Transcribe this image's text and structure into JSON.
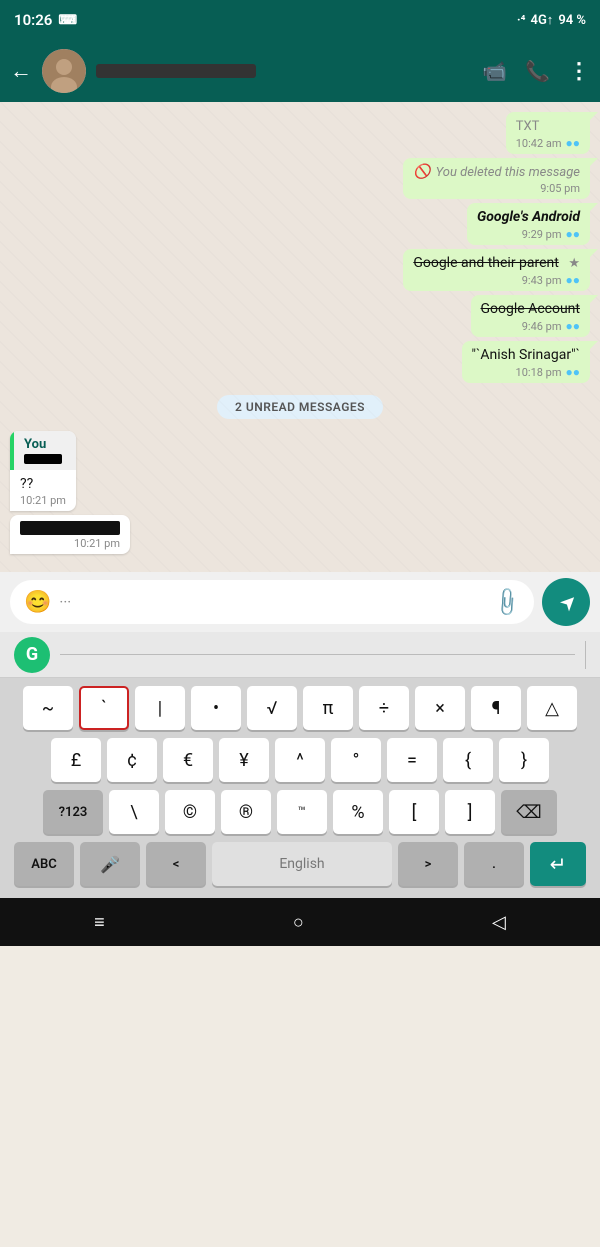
{
  "statusBar": {
    "time": "10:26",
    "signal": "4G↑",
    "battery": "94 %"
  },
  "header": {
    "back_label": "←",
    "name_redacted": true,
    "video_icon": "📹",
    "call_icon": "📞",
    "more_icon": "⋮"
  },
  "chat": {
    "messages": [
      {
        "type": "sent",
        "text": "TXT",
        "time": "10:42 am",
        "ticks": "●●",
        "strikethrough": false,
        "deleted": false,
        "italic": false
      },
      {
        "type": "sent",
        "text": "You deleted this message",
        "time": "9:05 pm",
        "deleted": true,
        "ticks": "",
        "strikethrough": false,
        "italic": false
      },
      {
        "type": "sent",
        "text": "Google's Android",
        "time": "9:29 pm",
        "ticks": "●●",
        "strikethrough": false,
        "deleted": false,
        "italic": true
      },
      {
        "type": "sent",
        "text": "Google and their parent",
        "time": "9:43 pm",
        "ticks": "●●",
        "strikethrough": true,
        "deleted": false,
        "italic": false
      },
      {
        "type": "sent",
        "text": "Google Account",
        "time": "9:46 pm",
        "ticks": "●●",
        "strikethrough": true,
        "deleted": false,
        "italic": false
      },
      {
        "type": "sent",
        "text": "\"`Anish Srinagar\"`",
        "time": "10:18 pm",
        "ticks": "●●",
        "strikethrough": false,
        "deleted": false,
        "italic": false
      }
    ],
    "unread_label": "2 UNREAD MESSAGES",
    "quoted_message": {
      "sender": "You",
      "preview_redacted": true,
      "body_text": "??",
      "body_time": "10:21 pm",
      "redacted_time": "10:21 pm"
    }
  },
  "inputArea": {
    "emoji_icon": "😊",
    "placeholder": "···",
    "attachment_icon": "📎",
    "send_icon": "➤"
  },
  "keyboard": {
    "grammarly_label": "G",
    "row1": [
      "~",
      "`",
      "|",
      "•",
      "√",
      "π",
      "÷",
      "×",
      "¶",
      "△"
    ],
    "row2": [
      "£",
      "¢",
      "€",
      "¥",
      "^",
      "°",
      "=",
      "{",
      "}"
    ],
    "special_left": "?123",
    "backslash": "\\",
    "copyright": "©",
    "registered": "®",
    "trademark": "™",
    "percent": "%",
    "bracket_open": "[",
    "bracket_close": "]",
    "backspace_icon": "⌫",
    "abc_label": "ABC",
    "mic_icon": "🎤",
    "lt": "<",
    "space_label": "English",
    "gt": ">",
    "period": ".",
    "enter_icon": "↵"
  },
  "bottomNav": {
    "home_icon": "≡",
    "circle_icon": "○",
    "back_icon": "◁"
  }
}
